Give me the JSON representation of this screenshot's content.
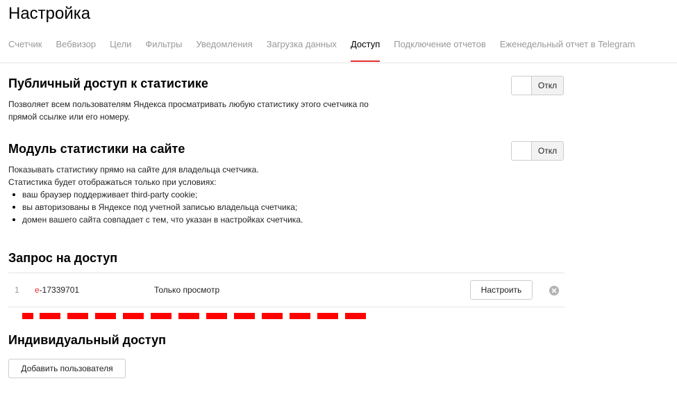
{
  "page": {
    "title": "Настройка"
  },
  "tabs": [
    {
      "label": "Счетчик",
      "active": false
    },
    {
      "label": "Вебвизор",
      "active": false
    },
    {
      "label": "Цели",
      "active": false
    },
    {
      "label": "Фильтры",
      "active": false
    },
    {
      "label": "Уведомления",
      "active": false
    },
    {
      "label": "Загрузка данных",
      "active": false
    },
    {
      "label": "Доступ",
      "active": true
    },
    {
      "label": "Подключение отчетов",
      "active": false
    },
    {
      "label": "Еженедельный отчет в Telegram",
      "active": false
    }
  ],
  "public_access": {
    "title": "Публичный доступ к статистике",
    "description_line1": "Позволяет всем пользователям Яндекса просматривать любую статистику этого счетчика по",
    "description_line2": "прямой ссылке или его номеру.",
    "toggle_label": "Откл"
  },
  "stats_module": {
    "title": "Модуль статистики на сайте",
    "description_line1": "Показывать статистику прямо на сайте для владельца счетчика.",
    "description_line2": "Статистика будет отображаться только при условиях:",
    "conditions": [
      "ваш браузер поддерживает third-party cookie;",
      "вы авторизованы в Яндексе под учетной записью владельца счетчика;",
      "домен вашего сайта совпадает с тем, что указан в настройках счетчика."
    ],
    "toggle_label": "Откл"
  },
  "access_request": {
    "title": "Запрос на доступ",
    "rows": [
      {
        "num": "1",
        "login_first": "e",
        "login_rest": "-17339701",
        "permission": "Только просмотр",
        "configure_label": "Настроить"
      }
    ]
  },
  "individual_access": {
    "title": "Индивидуальный доступ",
    "add_user_label": "Добавить пользователя"
  },
  "colors": {
    "accent": "#e52d2d",
    "tab_inactive": "#999999",
    "redaction": "#ff0000"
  }
}
